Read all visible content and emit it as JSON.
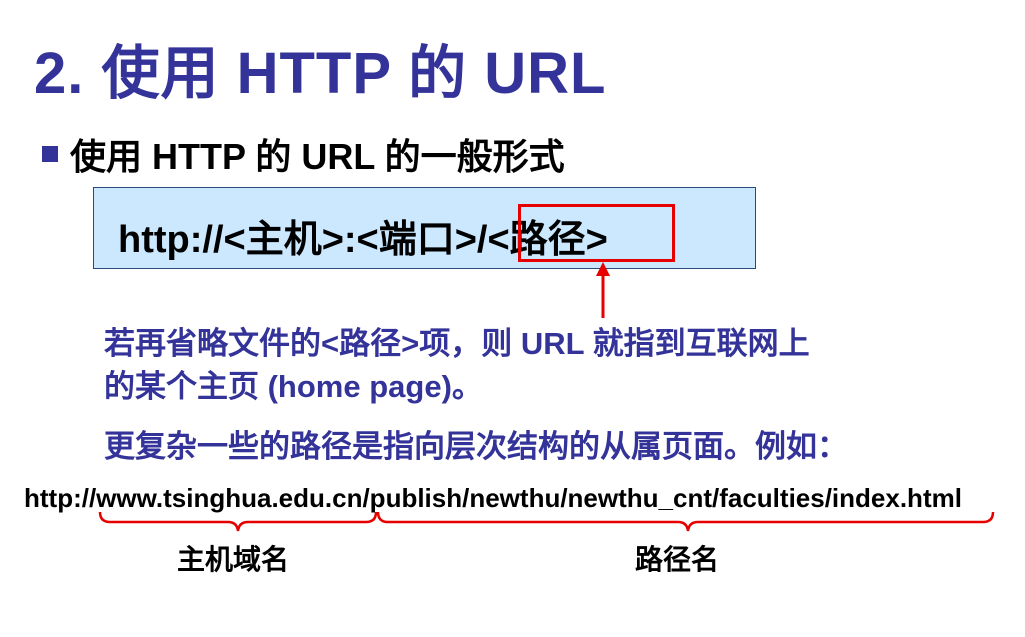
{
  "slide": {
    "title": "2. 使用 HTTP 的 URL",
    "bullet": "使用 HTTP 的 URL 的一般形式",
    "url_format": "http://<主机>:<端口>/<路径>",
    "note_line1": "若再省略文件的<路径>项，则 URL 就指到互联网上",
    "note_line2": "的某个主页 (home page)。",
    "note_line3": "更复杂一些的路径是指向层次结构的从属页面。例如：",
    "example_url": "http://www.tsinghua.edu.cn/publish/newthu/newthu_cnt/faculties/index.html",
    "host_label": "主机域名",
    "path_label": "路径名"
  },
  "colors": {
    "title": "#333399",
    "box_fill": "#cce8ff",
    "highlight": "#e60000"
  }
}
